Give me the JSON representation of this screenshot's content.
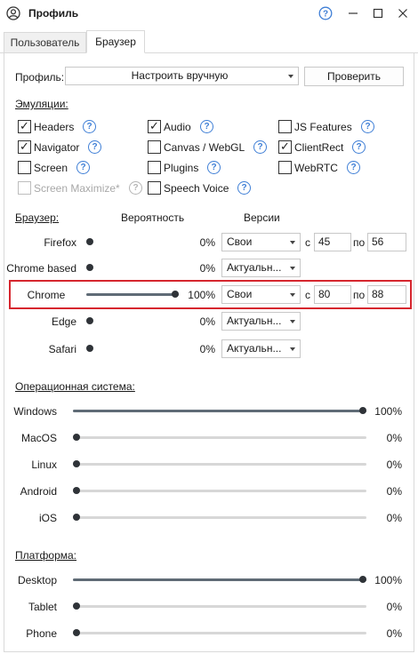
{
  "window": {
    "title": "Профиль"
  },
  "tabs": [
    {
      "label": "Пользователь"
    },
    {
      "label": "Браузер"
    }
  ],
  "profile": {
    "label": "Профиль:",
    "value": "Настроить вручную",
    "check_button": "Проверить"
  },
  "emulations": {
    "title": "Эмуляции:",
    "items": [
      {
        "label": "Headers",
        "checked": true
      },
      {
        "label": "Audio",
        "checked": true
      },
      {
        "label": "JS Features",
        "checked": false
      },
      {
        "label": "Navigator",
        "checked": true
      },
      {
        "label": "Canvas / WebGL",
        "checked": false
      },
      {
        "label": "ClientRect",
        "checked": true
      },
      {
        "label": "Screen",
        "checked": false
      },
      {
        "label": "Plugins",
        "checked": false
      },
      {
        "label": "WebRTC",
        "checked": false
      },
      {
        "label": "Screen Maximize*",
        "checked": false,
        "disabled": true
      },
      {
        "label": "Speech Voice",
        "checked": false
      }
    ]
  },
  "browser": {
    "title": "Браузер:",
    "col_probability": "Вероятность",
    "col_versions": "Версии",
    "from_label": "с",
    "to_label": "по",
    "rows": [
      {
        "name": "Firefox",
        "percent_text": "0%",
        "probability": 0,
        "version_mode": "Свои",
        "from": "45",
        "to": "56"
      },
      {
        "name": "Chrome based",
        "percent_text": "0%",
        "probability": 0,
        "version_mode": "Актуальн..."
      },
      {
        "name": "Chrome",
        "percent_text": "100%",
        "probability": 1,
        "version_mode": "Свои",
        "from": "80",
        "to": "88"
      },
      {
        "name": "Edge",
        "percent_text": "0%",
        "probability": 0,
        "version_mode": "Актуальн..."
      },
      {
        "name": "Safari",
        "percent_text": "0%",
        "probability": 0,
        "version_mode": "Актуальн..."
      }
    ]
  },
  "os": {
    "title": "Операционная система:",
    "rows": [
      {
        "name": "Windows",
        "percent_text": "100%",
        "value": 1
      },
      {
        "name": "MacOS",
        "percent_text": "0%",
        "value": 0
      },
      {
        "name": "Linux",
        "percent_text": "0%",
        "value": 0
      },
      {
        "name": "Android",
        "percent_text": "0%",
        "value": 0
      },
      {
        "name": "iOS",
        "percent_text": "0%",
        "value": 0
      }
    ]
  },
  "platform": {
    "title": "Платформа:",
    "rows": [
      {
        "name": "Desktop",
        "percent_text": "100%",
        "value": 1
      },
      {
        "name": "Tablet",
        "percent_text": "0%",
        "value": 0
      },
      {
        "name": "Phone",
        "percent_text": "0%",
        "value": 0
      }
    ]
  },
  "colors": {
    "accent": "#3f7fd6",
    "highlight": "#d6262e",
    "slider_fill": "#5f6b76",
    "slider_track": "#d7d7d7"
  }
}
